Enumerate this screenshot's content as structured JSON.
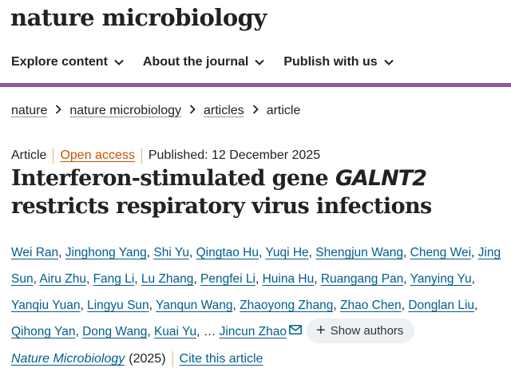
{
  "site": {
    "logo": "nature microbiology"
  },
  "nav": {
    "items": [
      {
        "label": "Explore content"
      },
      {
        "label": "About the journal"
      },
      {
        "label": "Publish with us"
      }
    ]
  },
  "breadcrumb": {
    "items": [
      "nature",
      "nature microbiology",
      "articles"
    ],
    "current": "article"
  },
  "article": {
    "type": "Article",
    "access": "Open access",
    "published": "Published: 12 December 2025",
    "title_part1": "Interferon-stimulated gene ",
    "title_gene": "GALNT2",
    "title_part2": " restricts respiratory virus infections",
    "authors": [
      "Wei Ran",
      "Jinghong Yang",
      "Shi Yu",
      "Qingtao Hu",
      "Yuqi He",
      "Shengjun Wang",
      "Cheng Wei",
      "Jing Sun",
      "Airu Zhu",
      "Fang Li",
      "Lu Zhang",
      "Pengfei Li",
      "Huina Hu",
      "Ruangang Pan",
      "Yanying Yu",
      "Yanqiu Yuan",
      "Lingyu Sun",
      "Yanqun Wang",
      "Zhaoyong Zhang",
      "Zhao Chen",
      "Donglan Liu",
      "Qihong Yan",
      "Dong Wang",
      "Kuai Yu"
    ],
    "ellipsis": "…",
    "last_author": "Jincun Zhao",
    "show_authors_label": "Show authors",
    "journal": "Nature Microbiology",
    "year": "(2025)",
    "cite_label": "Cite this article"
  },
  "icons": {
    "nav_chevron": "chevron-down-icon",
    "breadcrumb_separator": "chevron-right-icon",
    "corresponding_author": "envelope-icon",
    "expand": "plus-icon"
  },
  "colors": {
    "nav_rule": "#8c5a9a",
    "link_blue": "#025e8d",
    "open_access": "#c65301",
    "divider": "#d9b98a",
    "pill_bg": "#eef1f4"
  }
}
